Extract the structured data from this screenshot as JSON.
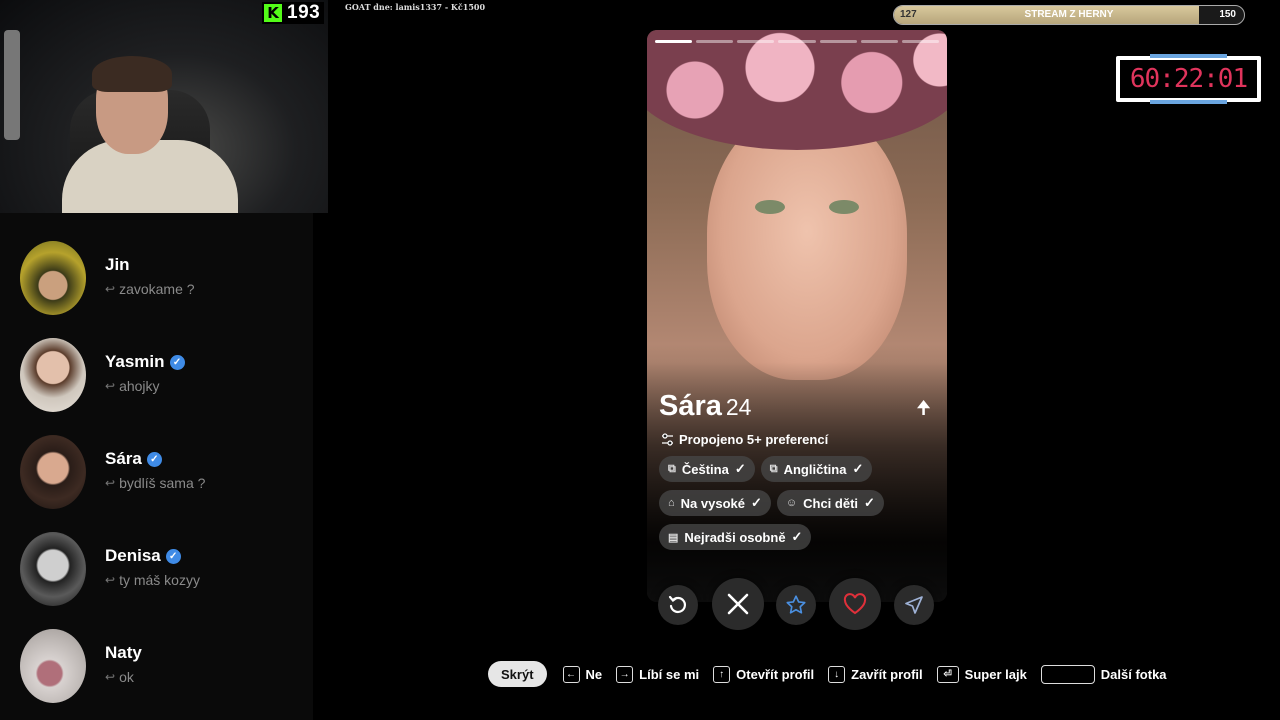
{
  "overlay": {
    "kick_count": "193",
    "goat_text": "GOAT dne: lamis1337 - Kč1500",
    "goal": {
      "min": "127",
      "max": "150",
      "label": "STREAM Z HERNY",
      "progress": 0.87
    },
    "timer": "60:22:01"
  },
  "chats": [
    {
      "name": "Jin",
      "verified": false,
      "message": "zavokame ?"
    },
    {
      "name": "Yasmin",
      "verified": true,
      "message": "ahojky"
    },
    {
      "name": "Sára",
      "verified": true,
      "message": "bydlíš sama ?"
    },
    {
      "name": "Denisa",
      "verified": true,
      "message": "ty máš kozyy"
    },
    {
      "name": "Naty",
      "verified": false,
      "message": "ok"
    }
  ],
  "profile": {
    "name": "Sára",
    "age": "24",
    "preferences": "Propojeno 5+ preferencí",
    "story_count": 7,
    "story_active": 0,
    "chips": [
      {
        "label": "Čeština",
        "icon": "language-icon"
      },
      {
        "label": "Angličtina",
        "icon": "language-icon"
      },
      {
        "label": "Na vysoké",
        "icon": "graduation-cap-icon"
      },
      {
        "label": "Chci děti",
        "icon": "baby-icon"
      },
      {
        "label": "Nejradši osobně",
        "icon": "chat-bubble-icon"
      }
    ]
  },
  "actions": [
    "rewind",
    "nope",
    "super-like",
    "like",
    "boost"
  ],
  "hints": {
    "hide": "Skrýt",
    "items": [
      {
        "key": "←",
        "label": "Ne"
      },
      {
        "key": "→",
        "label": "Líbí se mi"
      },
      {
        "key": "↑",
        "label": "Otevřít profil"
      },
      {
        "key": "↓",
        "label": "Zavřít profil"
      },
      {
        "key": "⏎",
        "label": "Super lajk"
      },
      {
        "key": "",
        "label": "Další fotka"
      }
    ]
  },
  "colors": {
    "kick_green": "#53fc18",
    "timer_red": "#e0345c",
    "verified_blue": "#3f8be6",
    "like_red": "#e0303a",
    "star_blue": "#4a8fe0"
  }
}
